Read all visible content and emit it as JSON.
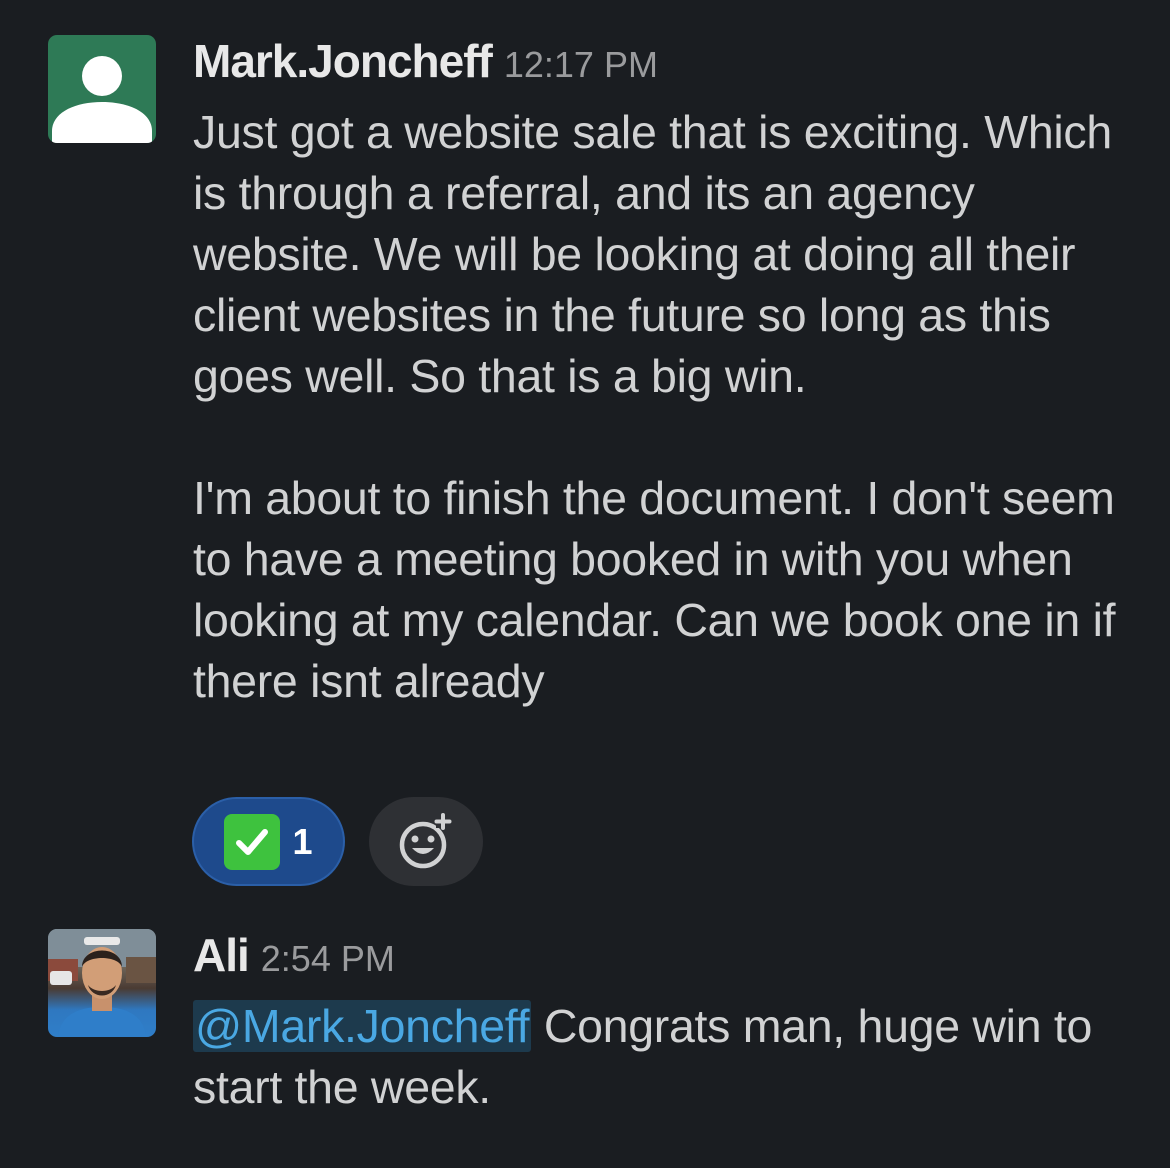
{
  "messages": [
    {
      "sender": "Mark.Joncheff",
      "time": "12:17 PM",
      "avatar": "default-user-icon",
      "paragraphs": [
        "Just got a website sale that is exciting. Which is through a referral, and its an agency website. We will be looking at doing all their client websites in the future so long as this goes well. So that is a big win.",
        "I'm about to finish the document. I don't seem to have a meeting booked in with you when looking at my calendar. Can we book one in if there isnt already"
      ],
      "reactions": [
        {
          "emoji": "white-check-mark",
          "count": "1",
          "active": true
        }
      ],
      "add_reaction_icon": "add-reaction-icon"
    },
    {
      "sender": "Ali",
      "time": "2:54 PM",
      "avatar": "user-photo",
      "mention": "@Mark.Joncheff",
      "text": " Congrats man, huge win to start the week."
    }
  ],
  "colors": {
    "background": "#1a1d21",
    "text": "#d1d2d3",
    "mention_text": "#4aa8e3",
    "mention_bg": "#1d3a4d",
    "reaction_active_bg": "#1e4a8c",
    "avatar_green": "#2e7a56"
  }
}
